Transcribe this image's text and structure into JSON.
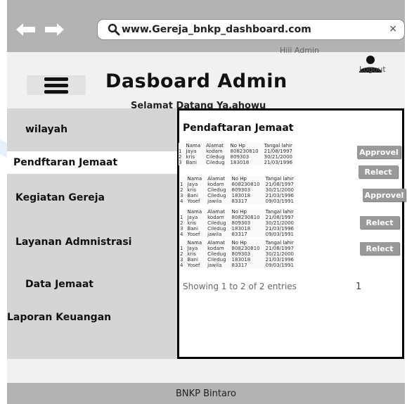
{
  "browser": {
    "url": "www.Gereja_bnkp_dashboard.com",
    "close_glyph": "×"
  },
  "header": {
    "greeting": "Hiii Admin",
    "logout_label": "Logout",
    "title": "Dasboard Admin",
    "subtitle": "Selamat Datang Ya,ahowu"
  },
  "sidebar": {
    "items": [
      {
        "label": "wilayah"
      },
      {
        "label": "Pendftaran Jemaat",
        "active": true
      },
      {
        "label": "Kegiatan Gereja"
      },
      {
        "label": "Layanan Admnistrasi"
      },
      {
        "label": "Data Jemaat"
      },
      {
        "label": "Laporan Keuangan"
      }
    ]
  },
  "main": {
    "title": "Pendaftaran Jemaat",
    "table": {
      "columns": [
        "Nama",
        "Alamat",
        "No Hp",
        "Tangal lahir"
      ],
      "rows": [
        [
          "1",
          "Jaya",
          "kodam",
          "808230810",
          "21/08/1997"
        ],
        [
          "2",
          "kris",
          "Ciledug",
          "809303",
          "30/21/2000"
        ],
        [
          "3",
          "Bani",
          "Ciledug",
          "183018",
          "21/03/1996"
        ],
        [
          "4",
          "Yosef",
          "jawila",
          "83317",
          "09/03/1991"
        ]
      ]
    },
    "buttons": {
      "approve_label": "Approvel",
      "reject_label": "Relect"
    },
    "showing_text": "Showing 1 to 2 of 2 entries",
    "page_number": "1"
  },
  "footer": {
    "label": "BNKP Bintaro"
  },
  "colors": {
    "chrome_gray": "#b3b3b3",
    "sidebar_gray": "#d5d5d5",
    "button_gray": "#999999",
    "background_accent": "#e6f0fb"
  }
}
